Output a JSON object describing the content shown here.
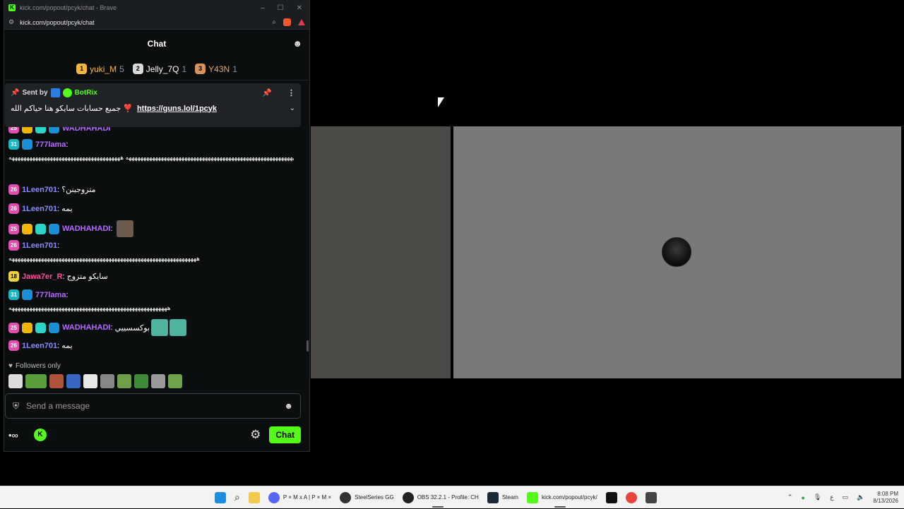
{
  "browser": {
    "title": "kick.com/popout/pcyk/chat - Brave",
    "url": "kick.com/popout/pcyk/chat",
    "controls": {
      "minimize": "–",
      "maximize": "☐",
      "close": "✕"
    }
  },
  "chat": {
    "header": "Chat",
    "leaderboard": [
      {
        "rank": "1",
        "name": "yuki_M",
        "count": "5",
        "color": "#f4b73e",
        "badge_color": "#f4b73e"
      },
      {
        "rank": "2",
        "name": "Jelly_7Q",
        "count": "1",
        "color": "#ffffff",
        "badge_color": "#d9d9d9"
      },
      {
        "rank": "3",
        "name": "Y43N",
        "count": "1",
        "color": "#e7a56b",
        "badge_color": "#d9925a"
      }
    ],
    "pinned": {
      "sent_by": "Sent by",
      "bot": "BotRix",
      "text": "جميع حسابات سايكو هنا حياكم الله ❣️",
      "link": "https://guns.lol/1pcyk"
    },
    "messages": [
      {
        "badge": "25",
        "user": "WADHAHADI",
        "user_color": "#b469ff",
        "text": ""
      },
      {
        "badge": "31",
        "user": "777lama",
        "user_color": "#b469ff",
        "text": "",
        "long": "ههههههههههههههههههههههههههههههههههههههههههههههههههههههههههههههههههههه ههههههههههههههههههههههههههههههههههههههه"
      },
      {
        "badge": "26",
        "user": "1Leen701",
        "user_color": "#8b8bff",
        "text": "متزوجينن؟"
      },
      {
        "badge": "26",
        "user": "1Leen701",
        "user_color": "#8b8bff",
        "text": "يمه"
      },
      {
        "badge": "25",
        "user": "WADHAHADI",
        "user_color": "#b469ff",
        "text": ""
      },
      {
        "badge": "26",
        "user": "1Leen701",
        "user_color": "#8b8bff",
        "text": "",
        "long": "ههههههههههههههههههههههههههههههههههههههههههههههههههههههههههههههههه"
      },
      {
        "badge": "18",
        "user": "Jawa7er_R",
        "user_color": "#ff4f9b",
        "text": "سايكو متزوج"
      },
      {
        "badge": "31",
        "user": "777lama",
        "user_color": "#b469ff",
        "text": "",
        "long": "ههههههههههههههههههههههههههههههههههههههههههههههههههههههه"
      },
      {
        "badge": "25",
        "user": "WADHAHADI",
        "user_color": "#b469ff",
        "text": "بوكسسييي"
      },
      {
        "badge": "26",
        "user": "1Leen701",
        "user_color": "#8b8bff",
        "text": "يمه"
      }
    ],
    "followers_only": "Followers only",
    "input_placeholder": "Send a message",
    "send_button": "Chat"
  },
  "taskbar": {
    "items": [
      {
        "label": "",
        "icon": "windows-start-icon"
      },
      {
        "label": "",
        "icon": "search-icon"
      },
      {
        "label": "",
        "icon": "file-explorer-icon"
      },
      {
        "label": "P × M x A | P × M ×",
        "icon": "discord-icon"
      },
      {
        "label": "SteelSeries GG",
        "icon": "steelseries-icon"
      },
      {
        "label": "OBS 32.2.1 - Profile: CH",
        "icon": "obs-icon"
      },
      {
        "label": "Steam",
        "icon": "steam-icon"
      },
      {
        "label": "kick.com/popout/pcyk/",
        "icon": "kick-icon"
      }
    ],
    "clock_time": "8:08 PM",
    "clock_date": "8/13/2026",
    "lang": "ع"
  },
  "colors": {
    "kick_green": "#53fc18",
    "chat_bg": "#0b0e0f"
  }
}
